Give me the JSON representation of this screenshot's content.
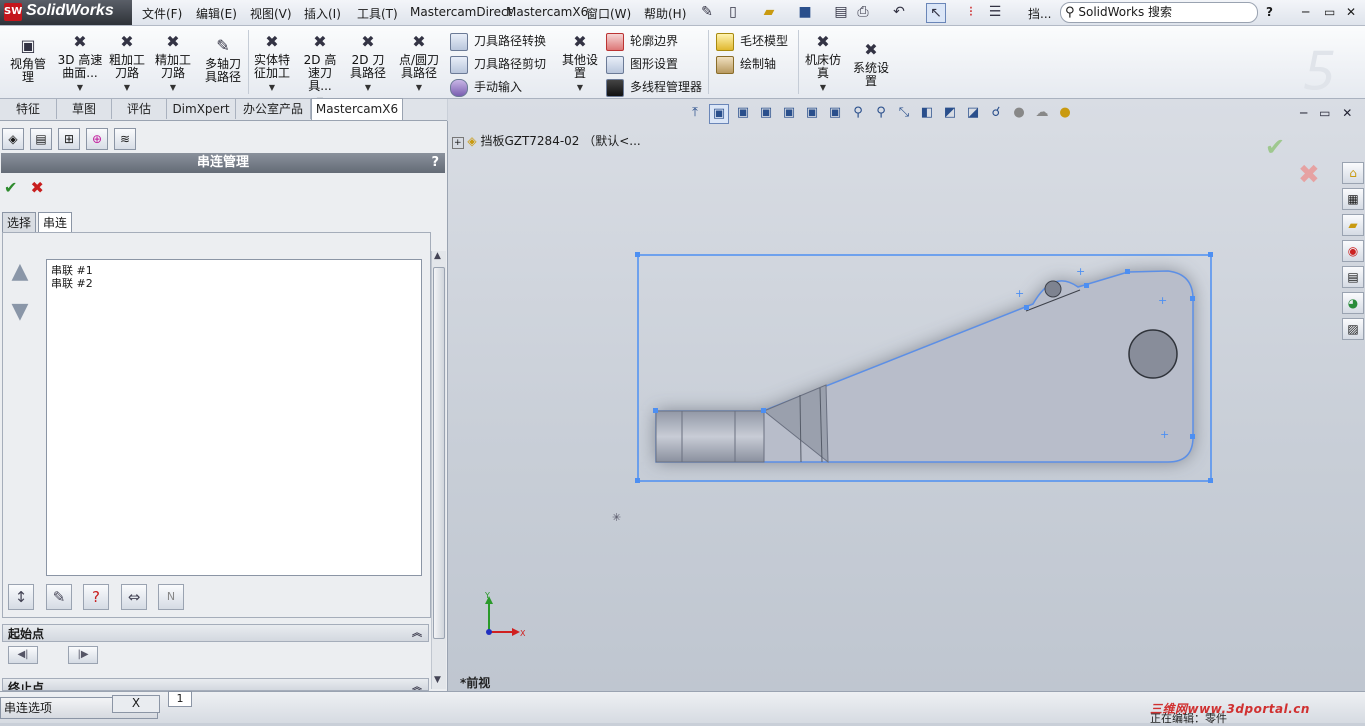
{
  "app": {
    "name": "SolidWorks",
    "badge": "SW"
  },
  "menu": [
    "文件(F)",
    "编辑(E)",
    "视图(V)",
    "插入(I)",
    "工具(T)",
    "MastercamDirect",
    "MastercamX6",
    "窗口(W)",
    "帮助(H)"
  ],
  "topbar": {
    "doc_label": "挡...",
    "search_placeholder": "SolidWorks 搜索",
    "help": "?"
  },
  "ribbon": {
    "big_buttons": [
      {
        "id": "view-manager",
        "label": "视角管理"
      },
      {
        "id": "3d-hsm",
        "label": "3D 高速曲面..."
      },
      {
        "id": "rough",
        "label": "粗加工刀路"
      },
      {
        "id": "finish",
        "label": "精加工刀路"
      },
      {
        "id": "multiaxis",
        "label": "多轴刀具路径"
      },
      {
        "id": "solid-feature",
        "label": "实体特征加工"
      },
      {
        "id": "2d-hsm",
        "label": "2D 高速刀具..."
      },
      {
        "id": "2d-path",
        "label": "2D 刀具路径"
      },
      {
        "id": "point-circle",
        "label": "点/圆刀具路径"
      },
      {
        "id": "other",
        "label": "其他设置"
      },
      {
        "id": "machine-sim",
        "label": "机床仿真"
      },
      {
        "id": "sys-settings",
        "label": "系统设置"
      }
    ],
    "small_col1": [
      "刀具路径转换",
      "刀具路径剪切",
      "手动输入"
    ],
    "small_col2": [
      "轮廓边界",
      "图形设置",
      "多线程管理器"
    ],
    "small_col3": [
      "毛坯模型",
      "绘制轴"
    ]
  },
  "command_tabs": [
    "特征",
    "草图",
    "评估",
    "DimXpert",
    "办公室产品",
    "MastercamX6"
  ],
  "property_manager": {
    "title": "串连管理",
    "help": "?",
    "tabs": [
      "选择",
      "串连"
    ],
    "chains": [
      "串联 #1",
      "串联 #2"
    ],
    "sections": {
      "start": "起始点",
      "end": "终止点"
    },
    "n_button": "N"
  },
  "graphics": {
    "tree_item": "挡板GZT7284-02 （默认<...",
    "view_name": "*前视",
    "axis_x": "X",
    "axis_y": "Y"
  },
  "statusbar": {
    "chain_options": "串连选项",
    "close": "X",
    "page": "1",
    "watermark": "三维网www.3dportal.cn",
    "editing": "正在编辑：零件"
  },
  "colors": {
    "accent_blue": "#4d8ff2",
    "part_fill": "#b7bcca",
    "header_gray": "#6e7580",
    "ok_green": "#2e8b2e",
    "cancel_red": "#c81e1e"
  }
}
